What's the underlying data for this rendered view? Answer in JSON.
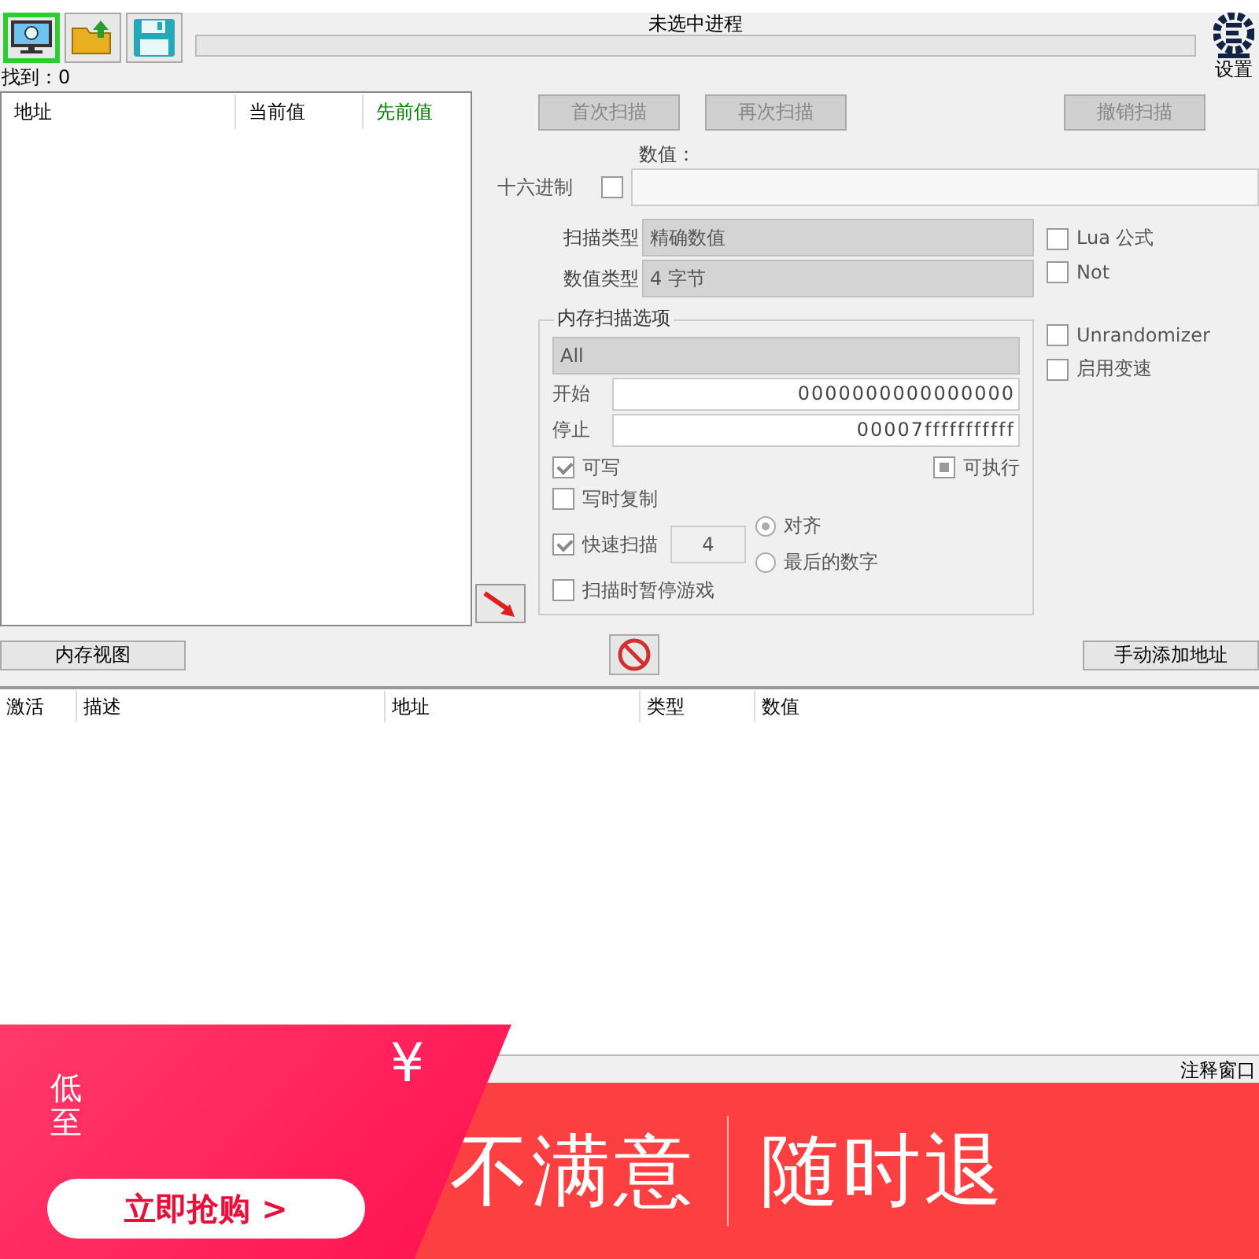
{
  "toolbar": {
    "process_title": "未选中进程",
    "settings_label": "设置"
  },
  "found": "找到：0",
  "results": {
    "columns": [
      {
        "label": "地址",
        "color": "#000000"
      },
      {
        "label": "当前值",
        "color": "#000000"
      },
      {
        "label": "先前值",
        "color": "#008000"
      }
    ]
  },
  "scan_buttons": [
    {
      "label": "首次扫描",
      "disabled": true
    },
    {
      "label": "再次扫描",
      "disabled": true
    },
    {
      "label": "撤销扫描",
      "disabled": true
    }
  ],
  "value": {
    "label": "数值：",
    "hex_label": "十六进制",
    "hex_checked": false
  },
  "scan_type": {
    "label": "扫描类型",
    "value": "精确数值"
  },
  "value_type": {
    "label": "数值类型",
    "value": "4 字节"
  },
  "memory_options": {
    "title": "内存扫描选项",
    "region": "All",
    "start_label": "开始",
    "start": "0000000000000000",
    "stop_label": "停止",
    "stop": "00007fffffffffff",
    "writable": {
      "label": "可写",
      "checked": true
    },
    "executable": {
      "label": "可执行",
      "indeterminate": true
    },
    "copy_on_write": {
      "label": "写时复制",
      "checked": false
    },
    "fast_scan": {
      "label": "快速扫描",
      "checked": true,
      "value": "4"
    },
    "alignment": [
      {
        "label": "对齐",
        "selected": true
      },
      {
        "label": "最后的数字",
        "selected": false
      }
    ],
    "pause": {
      "label": "扫描时暂停游戏",
      "checked": false
    }
  },
  "side_options": [
    {
      "label": "Lua 公式",
      "checked": false
    },
    {
      "label": "Not",
      "checked": false
    },
    {
      "label": "Unrandomizer",
      "checked": false
    },
    {
      "label": "启用变速",
      "checked": false
    }
  ],
  "memory_view_button": "内存视图",
  "add_address_button": "手动添加地址",
  "table": {
    "columns": [
      "激活",
      "描述",
      "地址",
      "类型",
      "数值"
    ]
  },
  "status_bar": "注释窗口",
  "banner": {
    "low_label": "低至",
    "currency": "¥",
    "buy_button": "立即抢购 >",
    "slogan_left": "不满意",
    "slogan_right": "随时退"
  }
}
